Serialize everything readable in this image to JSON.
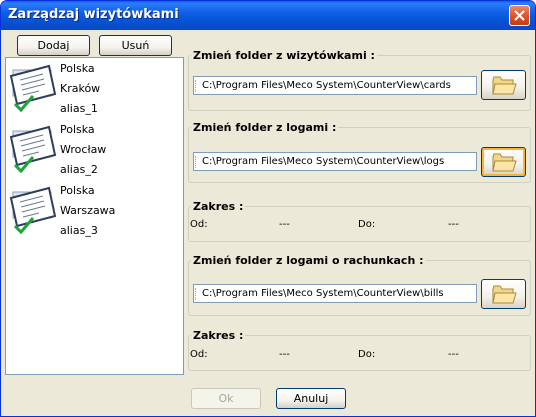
{
  "window": {
    "title": "Zarządzaj wizytówkami"
  },
  "toolbar": {
    "add_label": "Dodaj",
    "remove_label": "Usuń"
  },
  "cards": [
    {
      "country": "Polska",
      "city": "Kraków",
      "alias": "alias_1"
    },
    {
      "country": "Polska",
      "city": "Wrocław",
      "alias": "alias_2"
    },
    {
      "country": "Polska",
      "city": "Warszawa",
      "alias": "alias_3"
    }
  ],
  "cards_folder": {
    "label": "Zmień folder z wizytówkami :",
    "path": "C:\\Program Files\\Meco System\\CounterView\\cards"
  },
  "logs_folder": {
    "label": "Zmień folder z logami :",
    "path": "C:\\Program Files\\Meco System\\CounterView\\logs"
  },
  "range1": {
    "label": "Zakres :",
    "from_label": "Od:",
    "from_value": "---",
    "to_label": "Do:",
    "to_value": "---"
  },
  "bills_folder": {
    "label": "Zmień folder z logami o rachunkach :",
    "path": "C:\\Program Files\\Meco System\\CounterView\\bills"
  },
  "range2": {
    "label": "Zakres :",
    "from_label": "Od:",
    "from_value": "---",
    "to_label": "Do:",
    "to_value": "---"
  },
  "footer": {
    "ok_label": "Ok",
    "cancel_label": "Anuluj"
  },
  "colors": {
    "title_bar": "#0a5fe8",
    "close_button": "#d9562f",
    "dialog_bg": "#ece9d8",
    "check_green": "#1ea53a"
  }
}
